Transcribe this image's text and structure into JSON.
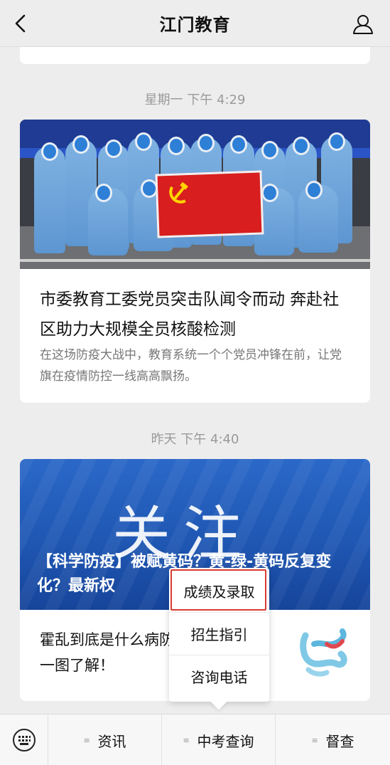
{
  "header": {
    "title": "江门教育",
    "back_icon": "chevron-left-icon",
    "profile_icon": "person-icon"
  },
  "feed": {
    "items": [
      {
        "timestamp": "星期一 下午 4:29",
        "title": "市委教育工委党员突击队闻令而动 奔赴社区助力大规模全员核酸检测",
        "description": "在这场防疫大战中，教育系统一个个党员冲锋在前，让党旗在疫情防控一线高高飘扬。"
      },
      {
        "timestamp": "昨天 下午 4:40",
        "banner_word": "关注",
        "headline": "【科学防疫】被赋黄码？黄-绿-黄码反复变化？最新权",
        "body": "霍乱到底是什么病防？一图了解！"
      }
    ]
  },
  "popup_menu": {
    "items": [
      "成绩及录取",
      "招生指引",
      "咨询电话"
    ],
    "highlight_color": "#d63b32"
  },
  "menu_bar": {
    "keyboard_icon": "keyboard-icon",
    "tabs": [
      "资讯",
      "中考查询",
      "督查"
    ],
    "tab_marker": "≡"
  },
  "colors": {
    "background": "#ededed",
    "flag_red": "#d81e1e",
    "banner_blue": "#1f57b3"
  }
}
